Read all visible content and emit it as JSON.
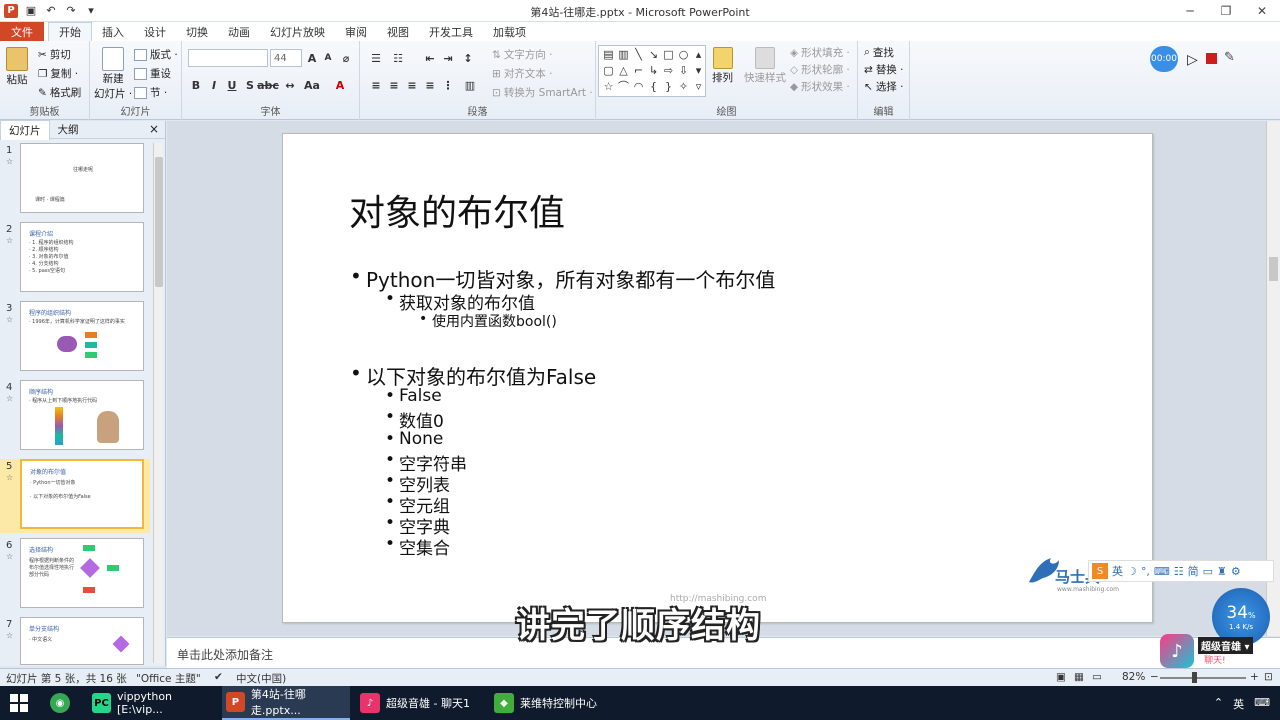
{
  "window": {
    "title": "第4站-往哪走.pptx - Microsoft PowerPoint",
    "logo_letter": "P",
    "qat": [
      "save-icon",
      "undo-icon",
      "redo-icon",
      "customize-icon"
    ]
  },
  "ribbon_tabs": [
    "文件",
    "开始",
    "插入",
    "设计",
    "切换",
    "动画",
    "幻灯片放映",
    "审阅",
    "视图",
    "开发工具",
    "加载项"
  ],
  "ribbon": {
    "clipboard": {
      "paste": "粘贴",
      "cut": "剪切",
      "copy": "复制 ·",
      "format_painter": "格式刷",
      "label": "剪贴板"
    },
    "slides": {
      "new_slide_1": "新建",
      "new_slide_2": "幻灯片 ·",
      "layout": "版式 ·",
      "reset": "重设",
      "section": "节 ·",
      "label": "幻灯片"
    },
    "font": {
      "font_size": "44",
      "label": "字体"
    },
    "paragraph": {
      "text_direction": "文字方向 ·",
      "align_text": "对齐文本 ·",
      "smartart": "转换为 SmartArt ·",
      "label": "段落"
    },
    "drawing": {
      "arrange": "排列",
      "quick_styles": "快速样式",
      "shape_fill": "形状填充 ·",
      "shape_outline": "形状轮廓 ·",
      "shape_effects": "形状效果 ·",
      "label": "绘图"
    },
    "editing": {
      "find": "查找",
      "replace": "替换 ·",
      "select": "选择 ·",
      "label": "编辑"
    }
  },
  "recorder": {
    "timer": "00:00"
  },
  "left_panel": {
    "tabs": [
      "幻灯片",
      "大纲"
    ],
    "close": "×",
    "thumbnails": [
      {
        "num": "1",
        "lines": [
          "往哪走呢",
          "课时 · 课程篇"
        ]
      },
      {
        "num": "2",
        "lines": [
          "课程介绍",
          "· 1. 程序的组织结构",
          "· 2. 顺序结构",
          "· 3. 对象的布尔值",
          "· 4. 分支结构",
          "· 5. pass空语句"
        ]
      },
      {
        "num": "3",
        "lines": [
          "程序的组织结构",
          "· 1996年，计算机科学家证明了这样的事实"
        ]
      },
      {
        "num": "4",
        "lines": [
          "顺序结构",
          "· 程序从上到下顺序地执行代码"
        ]
      },
      {
        "num": "5",
        "lines": [
          "对象的布尔值",
          "· Python一切皆对象",
          "· 以下对象的布尔值为False"
        ]
      },
      {
        "num": "6",
        "lines": [
          "选择结构",
          "程序根据判断条件的",
          "布尔值选择性地执行",
          "部分代码"
        ]
      },
      {
        "num": "7",
        "lines": [
          "单分支结构",
          "· 中文语义"
        ]
      }
    ]
  },
  "slide": {
    "title": "对象的布尔值",
    "l1a": "Python一切皆对象，所有对象都有一个布尔值",
    "l2a": "获取对象的布尔值",
    "l3a": "使用内置函数bool()",
    "l1b": "以下对象的布尔值为False",
    "items": [
      "False",
      "数值0",
      "None",
      "空字符串",
      "空列表",
      "空元组",
      "空字典",
      "空集合"
    ],
    "watermark": "http://mashibing.com"
  },
  "notes_placeholder": "单击此处添加备注",
  "subtitle": "讲完了顺序结构",
  "overlay": {
    "brand": "马士兵",
    "brand_url": "www.mashibing.com",
    "ime": [
      "英",
      "简"
    ],
    "net_pct": "34",
    "net_unit": "%",
    "net_speed": "1.4 K/s",
    "music_app": "超级音雄 ▾",
    "music_sub": "聊天!"
  },
  "status": {
    "slide_info": "幻灯片 第 5 张，共 16 张",
    "theme": "\"Office 主题\"",
    "lang": "中文(中国)",
    "zoom": "82%"
  },
  "taskbar": {
    "items": [
      {
        "label": "vippython [E:\\vip...",
        "icon": "PC",
        "color": "#21d789"
      },
      {
        "label": "第4站-往哪走.pptx...",
        "icon": "P",
        "color": "#d24726"
      },
      {
        "label": "超级音雄 - 聊天1",
        "icon": "♪",
        "color": "#e8336b"
      },
      {
        "label": "莱维特控制中心",
        "icon": "◆",
        "color": "#3fae3a"
      }
    ],
    "ime": "英"
  },
  "colors": {
    "accent": "#d24726",
    "ribbon_bg": "#e8eef6",
    "selection": "#f0b93b"
  }
}
